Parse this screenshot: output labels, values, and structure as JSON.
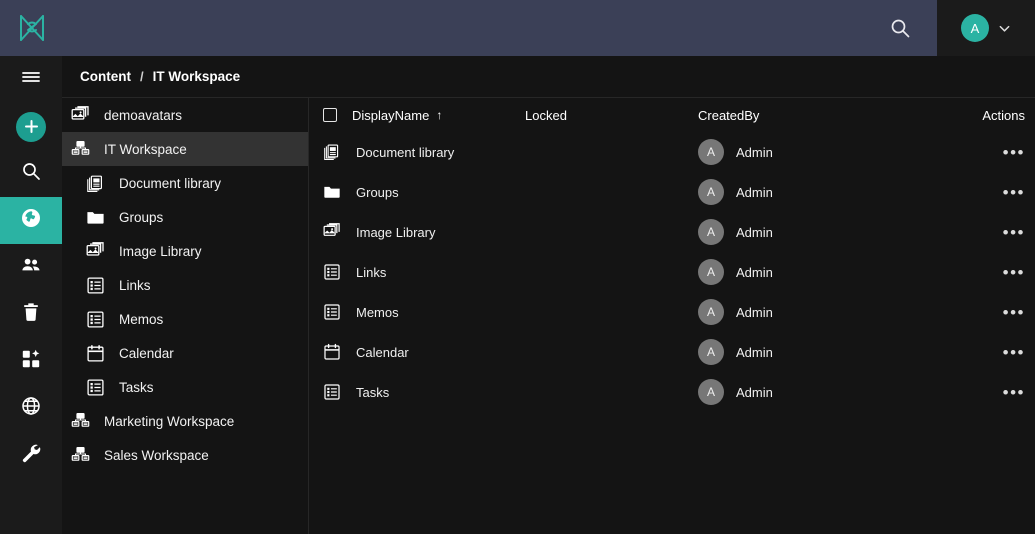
{
  "topbar": {
    "logo_icon": "umbraco-logo-icon",
    "search_icon": "search-icon",
    "avatar_initial": "A",
    "chevron_icon": "chevron-down-icon",
    "accent_color": "#2bb3a3",
    "background_color": "#3b4057"
  },
  "rail": {
    "items": [
      {
        "icon": "hamburger-menu-icon",
        "name": "menu-toggle",
        "active": false
      },
      {
        "icon": "plus-icon",
        "name": "create-button",
        "active": false
      },
      {
        "icon": "search-icon",
        "name": "rail-search",
        "active": false
      },
      {
        "icon": "globe-content-icon",
        "name": "rail-content",
        "active": true
      },
      {
        "icon": "users-icon",
        "name": "rail-users",
        "active": false
      },
      {
        "icon": "trash-icon",
        "name": "rail-recycle-bin",
        "active": false
      },
      {
        "icon": "packages-icon",
        "name": "rail-packages",
        "active": false
      },
      {
        "icon": "globe-icon",
        "name": "rail-translation",
        "active": false
      },
      {
        "icon": "wrench-icon",
        "name": "rail-settings",
        "active": false
      }
    ]
  },
  "breadcrumb": {
    "root": "Content",
    "separator": "/",
    "current": "IT Workspace"
  },
  "sidebar": {
    "items": [
      {
        "label": "demoavatars",
        "icon": "image-library-icon",
        "level": 0,
        "active": false
      },
      {
        "label": "IT Workspace",
        "icon": "workspace-icon",
        "level": 0,
        "active": true
      },
      {
        "label": "Document library",
        "icon": "document-library-icon",
        "level": 1,
        "active": false
      },
      {
        "label": "Groups",
        "icon": "folder-icon",
        "level": 1,
        "active": false
      },
      {
        "label": "Image Library",
        "icon": "image-library-icon",
        "level": 1,
        "active": false
      },
      {
        "label": "Links",
        "icon": "list-icon",
        "level": 1,
        "active": false
      },
      {
        "label": "Memos",
        "icon": "list-icon",
        "level": 1,
        "active": false
      },
      {
        "label": "Calendar",
        "icon": "calendar-icon",
        "level": 1,
        "active": false
      },
      {
        "label": "Tasks",
        "icon": "list-icon",
        "level": 1,
        "active": false
      },
      {
        "label": "Marketing Workspace",
        "icon": "workspace-icon",
        "level": 0,
        "active": false
      },
      {
        "label": "Sales Workspace",
        "icon": "workspace-icon",
        "level": 0,
        "active": false
      }
    ]
  },
  "table": {
    "columns": {
      "display_name": "DisplayName",
      "sort_indicator": "↑",
      "locked": "Locked",
      "created_by": "CreatedBy",
      "actions": "Actions"
    },
    "select_all_checked": false,
    "actions_glyph": "•••",
    "rows": [
      {
        "name": "Document library",
        "icon": "document-library-icon",
        "locked": "",
        "created_by": "Admin",
        "avatar_initial": "A"
      },
      {
        "name": "Groups",
        "icon": "folder-icon",
        "locked": "",
        "created_by": "Admin",
        "avatar_initial": "A"
      },
      {
        "name": "Image Library",
        "icon": "image-library-icon",
        "locked": "",
        "created_by": "Admin",
        "avatar_initial": "A"
      },
      {
        "name": "Links",
        "icon": "list-icon",
        "locked": "",
        "created_by": "Admin",
        "avatar_initial": "A"
      },
      {
        "name": "Memos",
        "icon": "list-icon",
        "locked": "",
        "created_by": "Admin",
        "avatar_initial": "A"
      },
      {
        "name": "Calendar",
        "icon": "calendar-icon",
        "locked": "",
        "created_by": "Admin",
        "avatar_initial": "A"
      },
      {
        "name": "Tasks",
        "icon": "list-icon",
        "locked": "",
        "created_by": "Admin",
        "avatar_initial": "A"
      }
    ]
  }
}
